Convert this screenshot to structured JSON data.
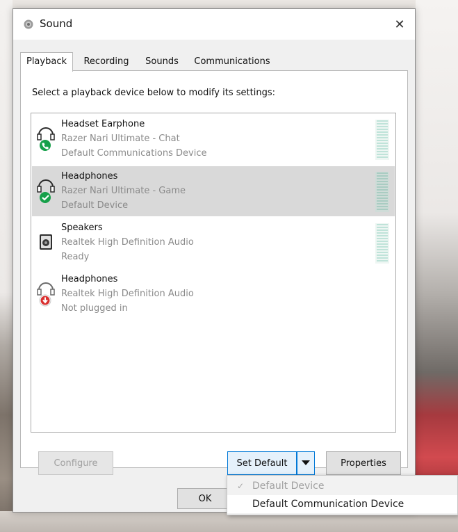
{
  "window": {
    "title": "Sound",
    "close_label": "✕"
  },
  "tabs": [
    {
      "label": "Playback",
      "active": true
    },
    {
      "label": "Recording",
      "active": false
    },
    {
      "label": "Sounds",
      "active": false
    },
    {
      "label": "Communications",
      "active": false
    }
  ],
  "instruction": "Select a playback device below to modify its settings:",
  "devices": [
    {
      "name": "Headset Earphone",
      "driver": "Razer Nari Ultimate - Chat",
      "status": "Default Communications Device",
      "badge": "phone-badge-icon",
      "badge_color": "#16a04a",
      "selected": false,
      "has_level_meter": true
    },
    {
      "name": "Headphones",
      "driver": "Razer Nari Ultimate - Game",
      "status": "Default Device",
      "badge": "check-badge-icon",
      "badge_color": "#16a04a",
      "selected": true,
      "has_level_meter": true
    },
    {
      "name": "Speakers",
      "driver": "Realtek High Definition Audio",
      "status": "Ready",
      "badge": "",
      "badge_color": "",
      "selected": false,
      "has_level_meter": true
    },
    {
      "name": "Headphones",
      "driver": "Realtek High Definition Audio",
      "status": "Not plugged in",
      "badge": "unplugged-badge-icon",
      "badge_color": "#d9302f",
      "selected": false,
      "has_level_meter": false
    }
  ],
  "buttons": {
    "configure": "Configure",
    "set_default": "Set Default",
    "properties": "Properties",
    "ok": "OK"
  },
  "menu": {
    "items": [
      {
        "label": "Default Device",
        "checked": true,
        "enabled": false
      },
      {
        "label": "Default Communication Device",
        "checked": false,
        "enabled": true
      }
    ]
  },
  "colors": {
    "accent": "#0078d7",
    "selection": "#d9d9d9",
    "disabled_text": "#a0a0a0",
    "level_meter": "#bfe3d9"
  }
}
